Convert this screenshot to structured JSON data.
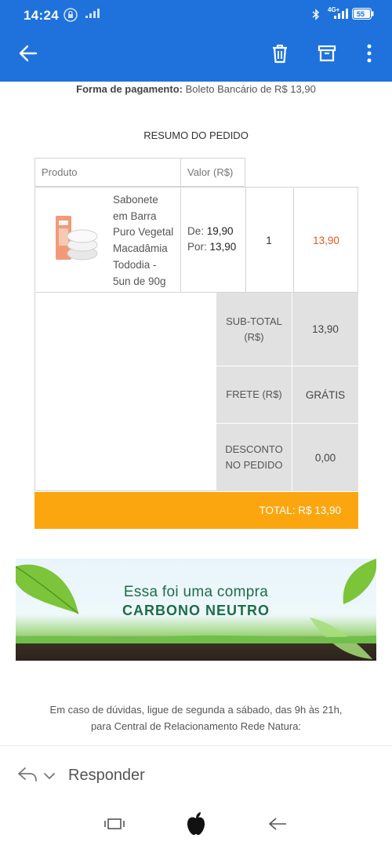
{
  "status_bar": {
    "time": "14:24",
    "battery": "55",
    "network": "4G+"
  },
  "email": {
    "payment_label": "Forma de pagamento:",
    "payment_value": "Boleto Bancário de R$ 13,90",
    "summary_title": "RESUMO DO PEDIDO",
    "table_headers": {
      "product": "Produto",
      "value": "Valor (R$)"
    },
    "item": {
      "name_lines": [
        "Sabonete",
        "em Barra",
        "Puro Vegetal",
        "Macadâmia",
        "Tododia -",
        "5un de 90g"
      ],
      "price_from_label": "De:",
      "price_from": "19,90",
      "price_to_label": "Por:",
      "price_to": "13,90",
      "quantity": "1",
      "total": "13,90"
    },
    "subtotal_label_lines": [
      "SUB-TOTAL",
      "(R$)"
    ],
    "subtotal_value": "13,90",
    "freight_label": "FRETE (R$)",
    "freight_value": "GRÁTIS",
    "discount_label_lines": [
      "DESCONTO",
      "NO PEDIDO"
    ],
    "discount_value": "0,00",
    "total_label": "TOTAL: R$ 13,90",
    "banner_line1": "Essa foi uma compra",
    "banner_line2": "CARBONO NEUTRO",
    "help_line1": "Em caso de dúvidas, ligue de segunda a sábado, das 9h às 21h,",
    "help_line2": "para Central de Relacionamento Rede Natura:"
  },
  "reply_bar": {
    "label": "Responder"
  },
  "colors": {
    "app_bar": "#1f72dc",
    "total_bar": "#fba60f",
    "item_total": "#e15a1f",
    "summary_cell": "#e1e1e1"
  },
  "icons": [
    "back-arrow-icon",
    "trash-icon",
    "archive-icon",
    "more-vert-icon",
    "reply-icon",
    "chevron-down-icon",
    "recents-icon",
    "home-apple-icon",
    "back-nav-icon"
  ]
}
